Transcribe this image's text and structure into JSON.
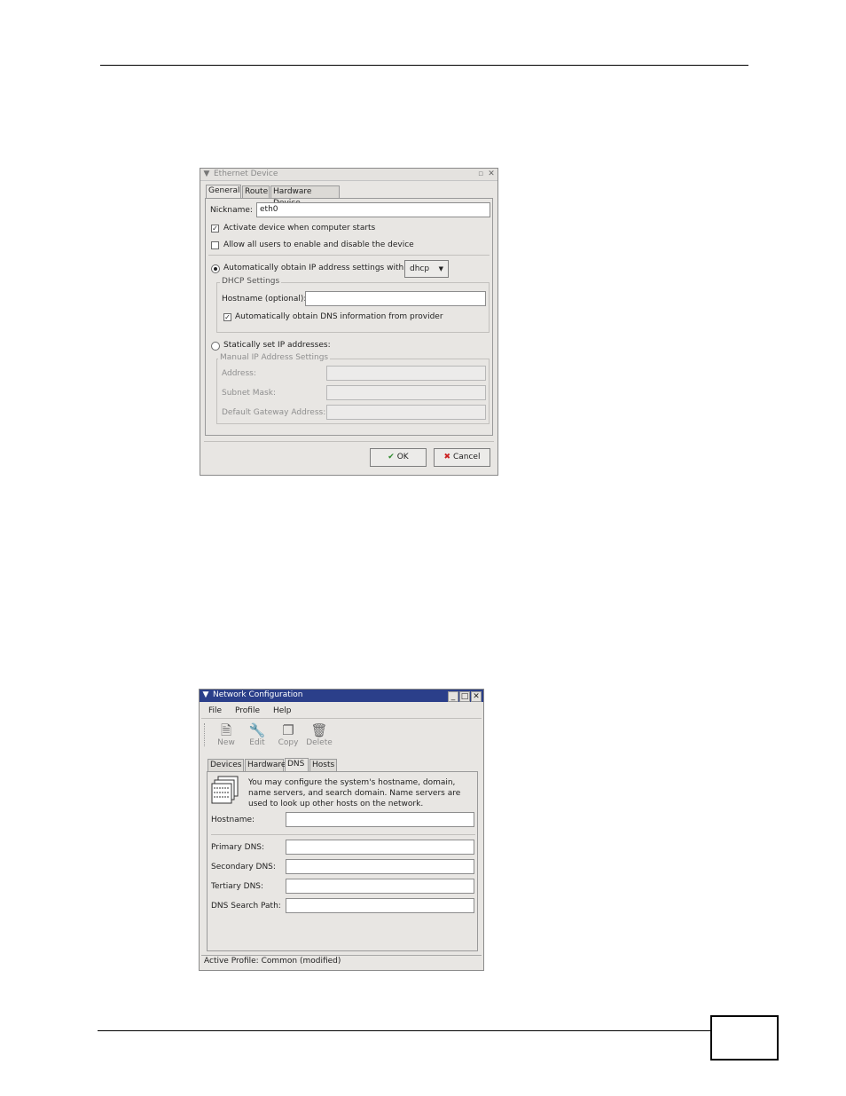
{
  "ethernet_dialog": {
    "title": "Ethernet Device",
    "tabs": [
      "General",
      "Route",
      "Hardware Device"
    ],
    "nickname_label": "Nickname:",
    "nickname_value": "eth0",
    "activate_label": "Activate device when computer starts",
    "activate_checked": true,
    "allow_users_label": "Allow all users to enable and disable the device",
    "allow_users_checked": false,
    "auto_obtain_label": "Automatically obtain IP address settings with:",
    "auto_obtain_selected": true,
    "protocol_value": "dhcp",
    "dhcp_group_label": "DHCP Settings",
    "hostname_label": "Hostname (optional):",
    "hostname_value": "",
    "auto_dns_label": "Automatically obtain DNS information from provider",
    "auto_dns_checked": true,
    "static_label": "Statically set IP addresses:",
    "manual_group_label": "Manual IP Address Settings",
    "address_label": "Address:",
    "subnet_label": "Subnet Mask:",
    "gateway_label": "Default Gateway Address:",
    "ok_label": "OK",
    "cancel_label": "Cancel"
  },
  "network_dialog": {
    "title": "Network Configuration",
    "menu": [
      "File",
      "Profile",
      "Help"
    ],
    "toolbar": [
      "New",
      "Edit",
      "Copy",
      "Delete"
    ],
    "tabs": [
      "Devices",
      "Hardware",
      "DNS",
      "Hosts"
    ],
    "description": "You may configure the system's hostname, domain, name servers, and search domain. Name servers are used to look up other hosts on the network.",
    "hostname_label": "Hostname:",
    "primary_dns_label": "Primary DNS:",
    "secondary_dns_label": "Secondary DNS:",
    "tertiary_dns_label": "Tertiary DNS:",
    "search_path_label": "DNS Search Path:",
    "status": "Active Profile: Common (modified)"
  },
  "colors": {
    "title_active": "#2b3f8a",
    "window_bg": "#e8e6e3",
    "ok_check": "#2e8b2e",
    "cancel_x": "#cc2222"
  }
}
